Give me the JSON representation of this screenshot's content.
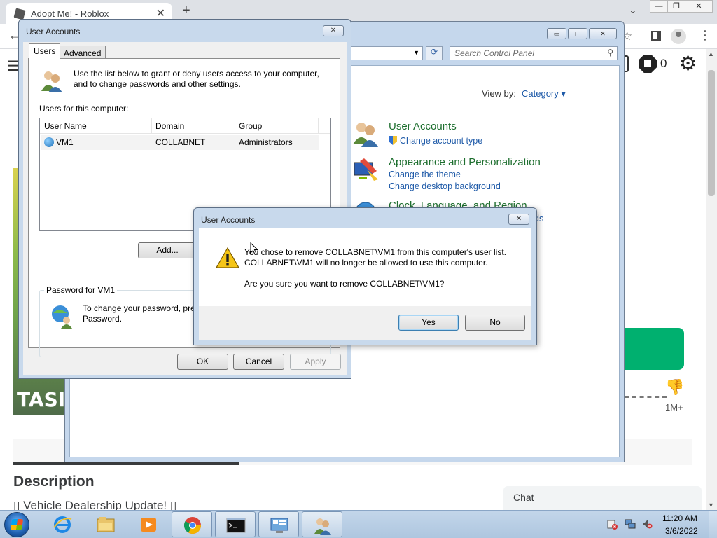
{
  "browser": {
    "tab_title": "Adopt Me! - Roblox",
    "tab_close": "✕",
    "new_tab": "+",
    "tab_dropdown": "⌄",
    "window_min": "—",
    "window_restore": "❐",
    "window_close": "✕",
    "star": "☆",
    "kebab": "⋮",
    "back": "←"
  },
  "roblox": {
    "menu_glyph": "☰",
    "robux_count": "0",
    "gear_glyph": "⚙",
    "game_thumb_text": "TASI",
    "votes": "1M+",
    "dislike_glyph": "👎",
    "description_title": "Description",
    "description_text": "▯ Vehicle Dealership Update! ▯",
    "chat_label": "Chat"
  },
  "control_panel": {
    "btn_min": "▭",
    "btn_max": "▢",
    "btn_close": "✕",
    "search_placeholder": "Search Control Panel",
    "refresh_glyph": "⟳",
    "view_by_label": "View by:",
    "view_by_value": "Category ▾",
    "categories": [
      {
        "title": "User Accounts",
        "links": [
          "Change account type"
        ]
      },
      {
        "title": "Appearance and Personalization",
        "links": [
          "Change the theme",
          "Change desktop background"
        ]
      },
      {
        "title": "Clock, Language, and Region",
        "links": [
          "ds"
        ]
      }
    ]
  },
  "user_accounts": {
    "title": "User Accounts",
    "close": "✕",
    "tabs": [
      "Users",
      "Advanced"
    ],
    "intro": "Use the list below to grant or deny users access to your computer, and to change passwords and other settings.",
    "users_label": "Users for this computer:",
    "columns": [
      "User Name",
      "Domain",
      "Group"
    ],
    "rows": [
      {
        "user": "VM1",
        "domain": "COLLABNET",
        "group": "Administrators"
      }
    ],
    "add_button": "Add...",
    "password_group": "Password for VM1",
    "password_text": "To change your password, pre Password.",
    "ok": "OK",
    "cancel": "Cancel",
    "apply": "Apply"
  },
  "confirm_dialog": {
    "title": "User Accounts",
    "close": "✕",
    "line1": "You chose to remove COLLABNET\\VM1 from this computer's user list.",
    "line2": "COLLABNET\\VM1 will no longer be allowed to use this computer.",
    "line3": "Are you sure you want to remove COLLABNET\\VM1?",
    "yes": "Yes",
    "no": "No"
  },
  "taskbar": {
    "items": [
      "internet-explorer",
      "file-explorer",
      "media-player",
      "chrome",
      "command-prompt",
      "control-panel",
      "user-accounts"
    ],
    "time": "11:20 AM",
    "date": "3/6/2022"
  }
}
